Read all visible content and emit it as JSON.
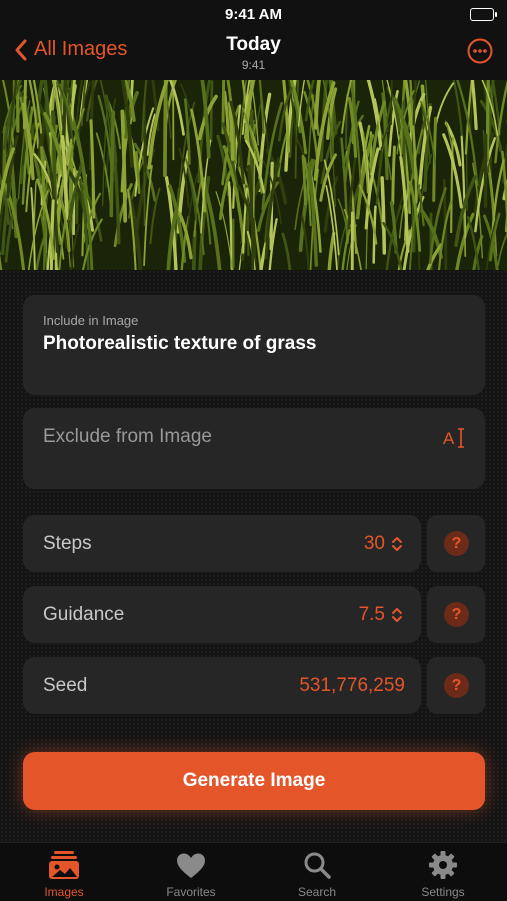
{
  "status_bar": {
    "time": "9:41 AM"
  },
  "nav": {
    "back_label": "All Images",
    "title": "Today",
    "subtitle": "9:41"
  },
  "include_field": {
    "label": "Include in Image",
    "value": "Photorealistic texture of grass"
  },
  "exclude_field": {
    "placeholder": "Exclude from Image"
  },
  "settings": [
    {
      "label": "Steps",
      "value": "30"
    },
    {
      "label": "Guidance",
      "value": "7.5"
    },
    {
      "label": "Seed",
      "value": "531,776,259"
    }
  ],
  "help_symbol": "?",
  "generate_button": {
    "label": "Generate Image"
  },
  "tabs": [
    {
      "label": "Images",
      "icon": "photo-stack-icon",
      "active": true
    },
    {
      "label": "Favorites",
      "icon": "heart-icon",
      "active": false
    },
    {
      "label": "Search",
      "icon": "search-icon",
      "active": false
    },
    {
      "label": "Settings",
      "icon": "gear-icon",
      "active": false
    }
  ],
  "colors": {
    "accent": "#e4562a",
    "background": "#141414",
    "card": "#262626"
  }
}
